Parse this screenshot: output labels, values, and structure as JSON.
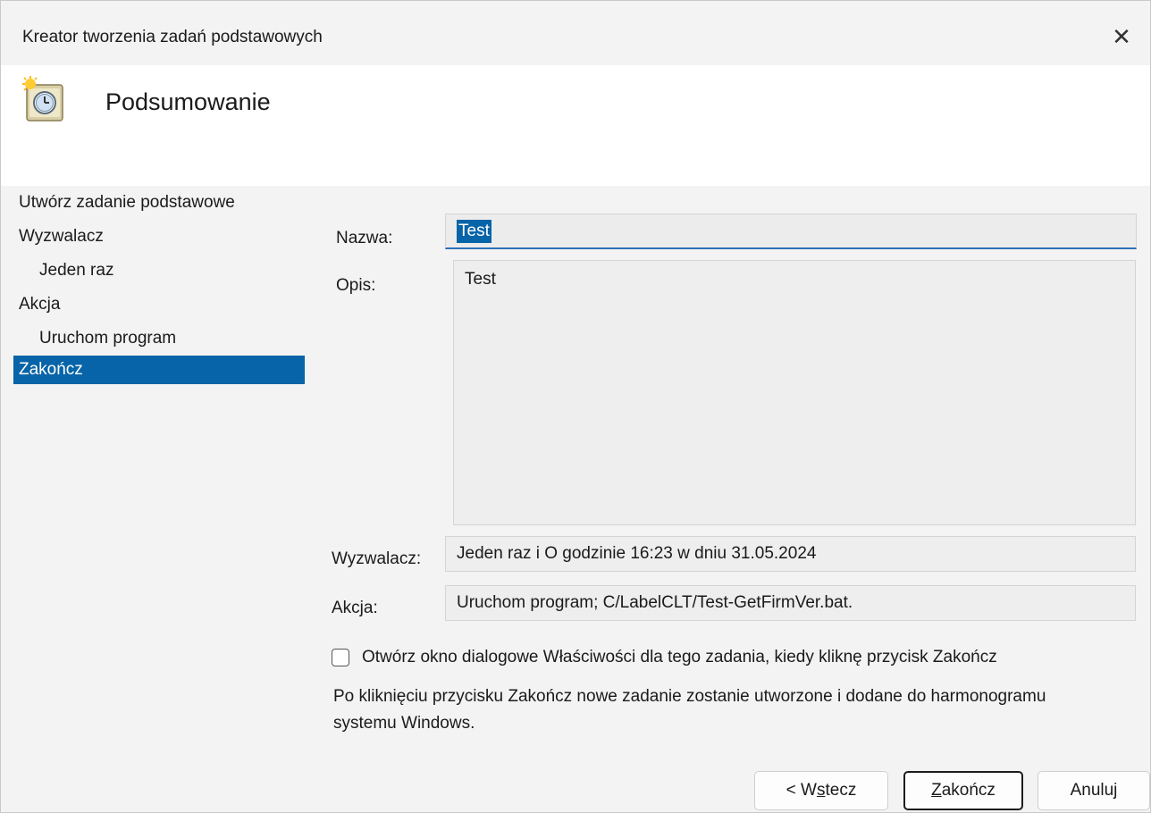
{
  "window": {
    "title": "Kreator tworzenia zadań podstawowych",
    "close_label": "✕"
  },
  "header": {
    "heading": "Podsumowanie",
    "icon": "scheduled-task-clock-icon"
  },
  "nav": {
    "items": [
      {
        "label": "Utwórz zadanie podstawowe",
        "level": 0,
        "selected": false
      },
      {
        "label": "Wyzwalacz",
        "level": 0,
        "selected": false
      },
      {
        "label": "Jeden raz",
        "level": 1,
        "selected": false
      },
      {
        "label": "Akcja",
        "level": 0,
        "selected": false
      },
      {
        "label": "Uruchom program",
        "level": 1,
        "selected": false
      },
      {
        "label": "Zakończ",
        "level": 0,
        "selected": true
      }
    ]
  },
  "form": {
    "name_label": "Nazwa:",
    "name_value": "Test",
    "desc_label": "Opis:",
    "desc_value": "Test",
    "trigger_label": "Wyzwalacz:",
    "trigger_value": "Jeden raz i O godzinie 16:23 w dniu 31.05.2024",
    "action_label": "Akcja:",
    "action_value": "Uruchom program; C/LabelCLT/Test-GetFirmVer.bat."
  },
  "checkbox": {
    "label": "Otwórz okno dialogowe Właściwości dla tego zadania, kiedy kliknę przycisk Zakończ",
    "checked": false
  },
  "info_text": "Po kliknięciu przycisku Zakończ nowe zadanie zostanie utworzone i dodane do harmonogramu systemu Windows.",
  "buttons": {
    "back": {
      "prefix": "< W",
      "mnemonic": "s",
      "suffix": "tecz"
    },
    "finish": {
      "prefix": "",
      "mnemonic": "Z",
      "suffix": "akończ"
    },
    "cancel": {
      "label": "Anuluj"
    }
  },
  "colors": {
    "selection": "#0764a8",
    "focus_underline": "#2c6fb8"
  }
}
